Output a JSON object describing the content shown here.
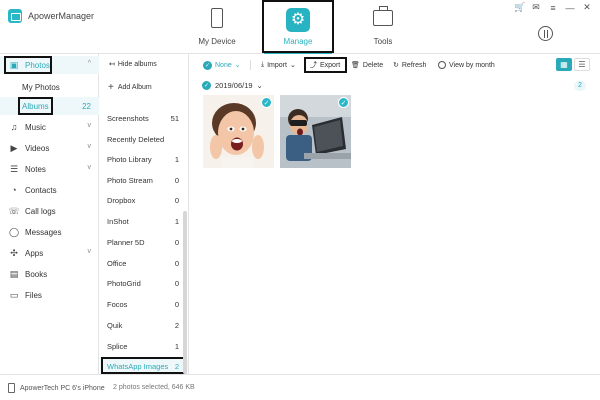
{
  "app": {
    "name": "ApowerManager"
  },
  "header": {
    "tabs": [
      {
        "label": "My Device",
        "icon": "phone-icon"
      },
      {
        "label": "Manage",
        "icon": "manage-icon",
        "active": true
      },
      {
        "label": "Tools",
        "icon": "toolbox-icon"
      }
    ],
    "accent_color": "#28b3c2"
  },
  "sidebar": {
    "items": [
      {
        "label": "Photos",
        "icon": "image-icon",
        "active": true
      },
      {
        "label": "Music",
        "icon": "music-icon"
      },
      {
        "label": "Videos",
        "icon": "video-icon"
      },
      {
        "label": "Notes",
        "icon": "notes-icon"
      },
      {
        "label": "Contacts",
        "icon": "contact-icon"
      },
      {
        "label": "Call logs",
        "icon": "phone-call-icon"
      },
      {
        "label": "Messages",
        "icon": "message-icon"
      },
      {
        "label": "Apps",
        "icon": "apps-icon"
      },
      {
        "label": "Books",
        "icon": "book-icon"
      },
      {
        "label": "Files",
        "icon": "file-icon"
      }
    ],
    "photo_sub": [
      {
        "label": "My Photos"
      },
      {
        "label": "Albums",
        "count": "22",
        "active": true
      }
    ]
  },
  "albums_panel": {
    "hide_label": "Hide albums",
    "add_label": "Add Album",
    "albums": [
      {
        "name": "Screenshots",
        "count": "51"
      },
      {
        "name": "Recently Deleted",
        "count": ""
      },
      {
        "name": "Photo Library",
        "count": "1"
      },
      {
        "name": "Photo Stream",
        "count": "0"
      },
      {
        "name": "Dropbox",
        "count": "0"
      },
      {
        "name": "InShot",
        "count": "1"
      },
      {
        "name": "Planner 5D",
        "count": "0"
      },
      {
        "name": "Office",
        "count": "0"
      },
      {
        "name": "PhotoGrid",
        "count": "0"
      },
      {
        "name": "Focos",
        "count": "0"
      },
      {
        "name": "Quik",
        "count": "2"
      },
      {
        "name": "Splice",
        "count": "1"
      },
      {
        "name": "WhatsApp Images",
        "count": "2",
        "active": true
      }
    ]
  },
  "toolbar": {
    "select_label": "None",
    "import_label": "Import",
    "export_label": "Export",
    "delete_label": "Delete",
    "refresh_label": "Refresh",
    "month_label": "View by month"
  },
  "content": {
    "date": "2019/06/19",
    "date_count": "2",
    "photos": [
      {
        "name": "surprised-woman-photo",
        "selected": true
      },
      {
        "name": "surprised-boy-laptop-photo",
        "selected": true
      }
    ]
  },
  "status": {
    "device": "ApowerTech PC 6's iPhone",
    "selection": "2 photos selected, 646 KB"
  }
}
